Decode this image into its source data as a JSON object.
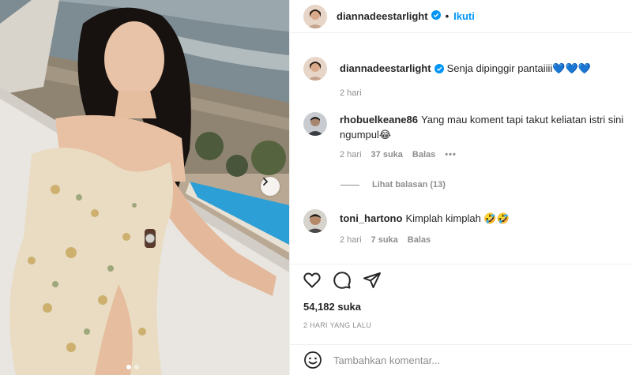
{
  "post": {
    "username": "diannadeestarlight",
    "follow_label": "Ikuti",
    "separator": "•",
    "caption": "Senja dipinggir pantaiiii💙💙💙",
    "caption_time": "2 hari"
  },
  "comments": [
    {
      "username": "rhobuelkeane86",
      "text_line1": "Yang mau koment tapi takut keliatan istri sini",
      "text_line2": "ngumpul😂",
      "time": "2 hari",
      "likes": "37 suka",
      "reply_label": "Balas",
      "more_label": "•••",
      "view_replies": "Lihat balasan (13)"
    },
    {
      "username": "toni_hartono",
      "text": "Kimplah kimplah 🤣🤣",
      "time": "2 hari",
      "likes": "7 suka",
      "reply_label": "Balas"
    }
  ],
  "stats": {
    "likes": "54,182 suka",
    "date": "2 HARI YANG LALU"
  },
  "composer": {
    "placeholder": "Tambahkan komentar..."
  },
  "icons": {
    "verified": "verified-badge-icon",
    "like": "heart-icon",
    "comment": "comment-icon",
    "share": "share-icon",
    "emoji": "emoji-icon",
    "next": "chevron-right-icon"
  },
  "colors": {
    "accent": "#0095f6",
    "muted": "#8e8e8e",
    "text": "#262626"
  }
}
